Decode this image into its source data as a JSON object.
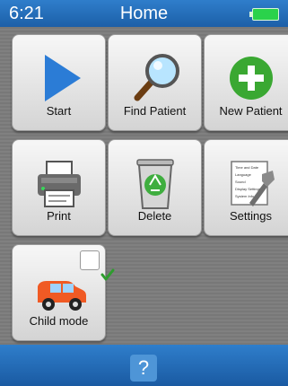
{
  "status_bar": {
    "time": "6:21",
    "title": "Home"
  },
  "tiles": [
    {
      "label": "Start",
      "icon": "play-icon"
    },
    {
      "label": "Find Patient",
      "icon": "magnifier-icon"
    },
    {
      "label": "New Patient",
      "icon": "plus-circle-icon"
    },
    {
      "label": "Print",
      "icon": "printer-icon"
    },
    {
      "label": "Delete",
      "icon": "recycle-bin-icon"
    },
    {
      "label": "Settings",
      "icon": "settings-icon"
    },
    {
      "label": "Child mode",
      "icon": "car-icon"
    }
  ],
  "settings_doc": {
    "lines": [
      "Time and Date",
      "Language",
      "Sound",
      "Display Settings",
      "System Info"
    ]
  },
  "help": {
    "label": "?"
  },
  "colors": {
    "bar_blue": "#1c5fa8",
    "play_blue": "#2b7cd6",
    "plus_green": "#3aa832",
    "check_green": "#2e9c2e"
  }
}
